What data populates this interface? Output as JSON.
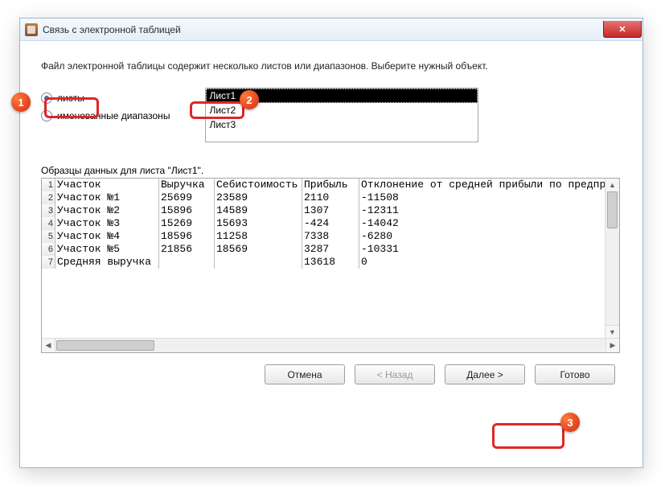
{
  "window": {
    "title": "Связь с электронной таблицей",
    "close_glyph": "✕"
  },
  "instruction": "Файл электронной таблицы содержит несколько листов или диапазонов.  Выберите нужный объект.",
  "radios": {
    "sheets": {
      "label": "листы",
      "selected": true
    },
    "ranges": {
      "label": "именованные диапазоны",
      "selected": false
    }
  },
  "listbox": {
    "items": [
      "Лист1",
      "Лист2",
      "Лист3"
    ],
    "selected_index": 0
  },
  "preview": {
    "label": "Образцы данных для листа \"Лист1\".",
    "columns": [
      "Участок",
      "Выручка",
      "Себистоимость",
      "Прибыль",
      "Отклонение от средней прибыли по предпри"
    ],
    "rows": [
      [
        "Участок №1",
        "25699",
        "23589",
        "2110",
        "-11508"
      ],
      [
        "Участок №2",
        "15896",
        "14589",
        "1307",
        "-12311"
      ],
      [
        "Участок №3",
        "15269",
        "15693",
        "-424",
        "-14042"
      ],
      [
        "Участок №4",
        "18596",
        "11258",
        "7338",
        "-6280"
      ],
      [
        "Участок №5",
        "21856",
        "18569",
        "3287",
        "-10331"
      ],
      [
        "Средняя выручка",
        "",
        "",
        "13618",
        "0"
      ]
    ]
  },
  "buttons": {
    "cancel": "Отмена",
    "back": "< Назад",
    "next": "Далее >",
    "finish": "Готово"
  },
  "annotations": {
    "one": "1",
    "two": "2",
    "three": "3"
  }
}
